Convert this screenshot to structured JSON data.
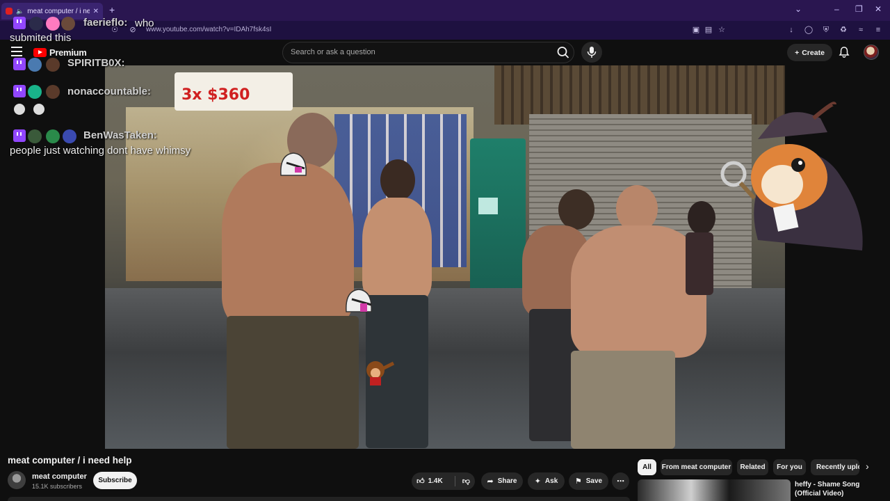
{
  "browser": {
    "tab_title": "meat computer / i need help",
    "url": "www.youtube.com/watch?v=IDAh7fsk4sI"
  },
  "header": {
    "logo_text": "Premium",
    "search_placeholder": "Search or ask a question",
    "create_label": "Create"
  },
  "chat": {
    "messages": [
      {
        "user": "faerieflo:",
        "text": "who"
      },
      {
        "user": "",
        "text": "submited this"
      },
      {
        "user": "SPIRITB0X:",
        "text": ""
      },
      {
        "user": "nonaccountable:",
        "text": ""
      },
      {
        "user": "BenWasTaken:",
        "text": ""
      },
      {
        "user": "",
        "text": "people just watching dont have whimsy"
      }
    ]
  },
  "video": {
    "sign_price": "3x $360",
    "title": "meat computer / i need help"
  },
  "channel": {
    "name": "meat computer",
    "subscribers": "15.1K subscribers",
    "subscribe_label": "Subscribe"
  },
  "actions": {
    "likes": "1.4K",
    "share": "Share",
    "ask": "Ask",
    "save": "Save"
  },
  "chips": [
    "All",
    "From meat computer",
    "Related",
    "For you",
    "Recently uploaded"
  ],
  "recommendation": {
    "title": "heffy - Shame Song (Official Video)"
  },
  "colors": {
    "accent": "#ff0000",
    "twitch": "#9146ff",
    "browser_tabbar": "#2a1650"
  }
}
